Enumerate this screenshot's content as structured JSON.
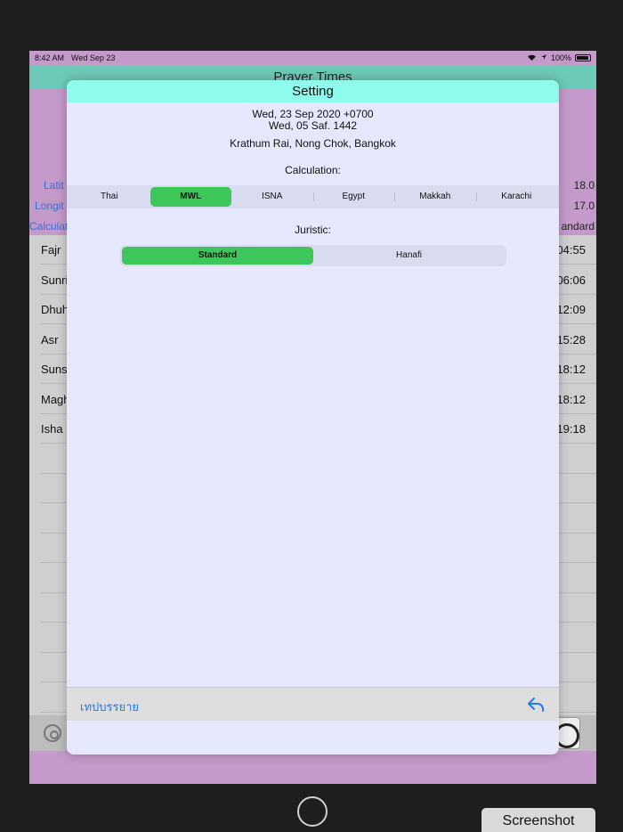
{
  "status_bar": {
    "time": "8:42 AM",
    "date": "Wed Sep 23",
    "battery": "100%"
  },
  "background": {
    "title": "Prayer Times",
    "info": [
      {
        "label": "Latit",
        "value": "18.0"
      },
      {
        "label": "Longit",
        "value": "17.0"
      },
      {
        "label": "Calculat",
        "value": "andard"
      }
    ],
    "prayers": [
      {
        "name": "Fajr",
        "time": "04:55"
      },
      {
        "name": "Sunri",
        "time": "06:06"
      },
      {
        "name": "Dhuh",
        "time": "12:09"
      },
      {
        "name": "Asr",
        "time": "15:28"
      },
      {
        "name": "Suns",
        "time": "18:12"
      },
      {
        "name": "Magh",
        "time": "18:12"
      },
      {
        "name": "Isha",
        "time": "19:18"
      }
    ]
  },
  "modal": {
    "title": "Setting",
    "date_gregorian": "Wed, 23 Sep 2020 +0700",
    "date_hijri": "Wed, 05 Saf. 1442",
    "location": "Krathum Rai, Nong Chok, Bangkok",
    "calculation_label": "Calculation:",
    "calculation_options": [
      "Thai",
      "MWL",
      "ISNA",
      "Egypt",
      "Makkah",
      "Karachi"
    ],
    "calculation_selected": "MWL",
    "juristic_label": "Juristic:",
    "juristic_options": [
      "Standard",
      "Hanafi"
    ],
    "juristic_selected": "Standard",
    "footer_link": "เทปบรรยาย"
  },
  "screenshot_label": "Screenshot",
  "colors": {
    "accent_green": "#3dc75a",
    "header_teal": "#8efcec",
    "link_blue": "#2a7ae2"
  }
}
